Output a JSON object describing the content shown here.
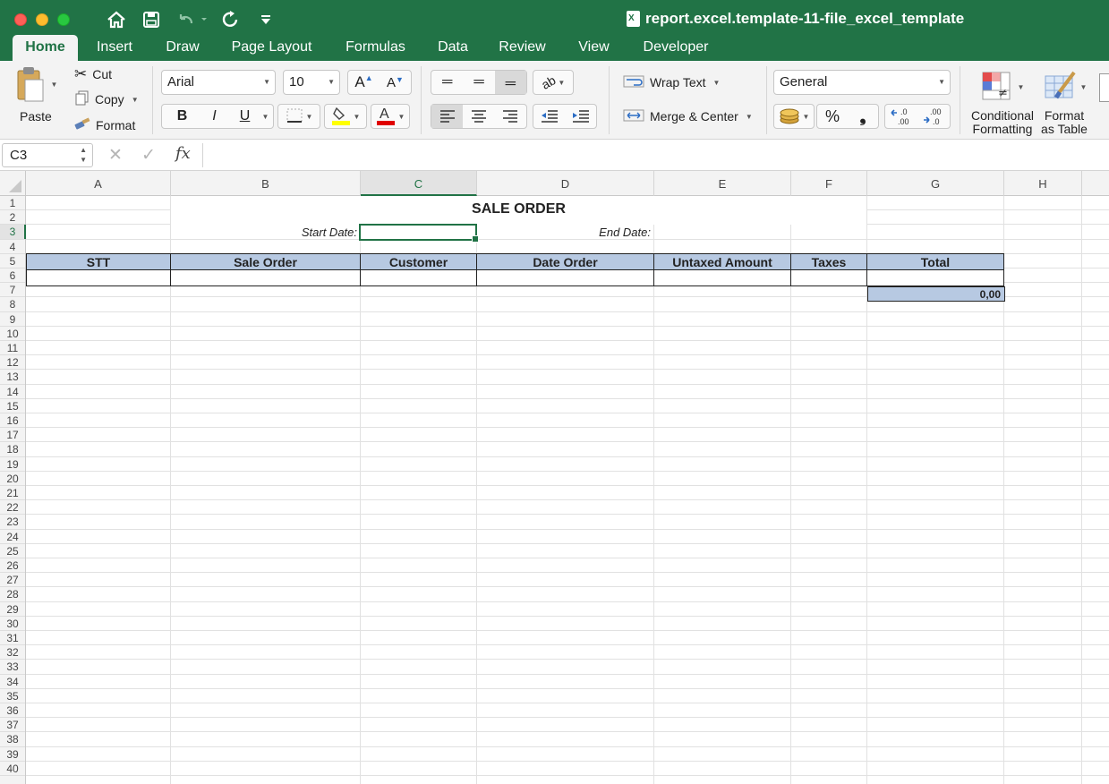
{
  "window": {
    "title": "report.excel.template-11-file_excel_template"
  },
  "tabs": [
    "Home",
    "Insert",
    "Draw",
    "Page Layout",
    "Formulas",
    "Data",
    "Review",
    "View",
    "Developer"
  ],
  "ribbon": {
    "paste_label": "Paste",
    "cut_label": "Cut",
    "copy_label": "Copy",
    "format_label": "Format",
    "font_name": "Arial",
    "font_size": "10",
    "bold": "B",
    "italic": "I",
    "underline": "U",
    "wrap_text_label": "Wrap Text",
    "merge_center_label": "Merge & Center",
    "number_format": "General",
    "percent": "%",
    "comma": "❟",
    "increase_decimal": ".0\n.00",
    "conditional_formatting_label": [
      "Conditional",
      "Formatting"
    ],
    "format_as_table_label": [
      "Format",
      "as Table"
    ],
    "font_color_hex": "#e00000",
    "highlight_color_hex": "#ffff00"
  },
  "formula_bar": {
    "name_box": "C3",
    "fx": "fx",
    "formula": ""
  },
  "sheet": {
    "columns": [
      "A",
      "B",
      "C",
      "D",
      "E",
      "F",
      "G",
      "H"
    ],
    "selected_column": "C",
    "selected_row": "3",
    "rows": [
      "1",
      "2",
      "3",
      "4",
      "5",
      "6",
      "7",
      "8",
      "9",
      "10",
      "11",
      "12",
      "13",
      "14",
      "15",
      "16",
      "17",
      "18",
      "19",
      "20",
      "21",
      "22",
      "23",
      "24",
      "25",
      "26",
      "27",
      "28",
      "29",
      "30",
      "31",
      "32",
      "33",
      "34",
      "35",
      "36",
      "37",
      "38",
      "39",
      "40"
    ],
    "title": "SALE ORDER",
    "start_date_label": "Start Date:",
    "end_date_label": "End Date:",
    "table_headers": [
      "STT",
      "Sale Order",
      "Customer",
      "Date Order",
      "Untaxed Amount",
      "Taxes",
      "Total"
    ],
    "total_value": "0,00",
    "header_fill_hex": "#b7c9e2"
  },
  "colors": {
    "accent": "#217346"
  }
}
